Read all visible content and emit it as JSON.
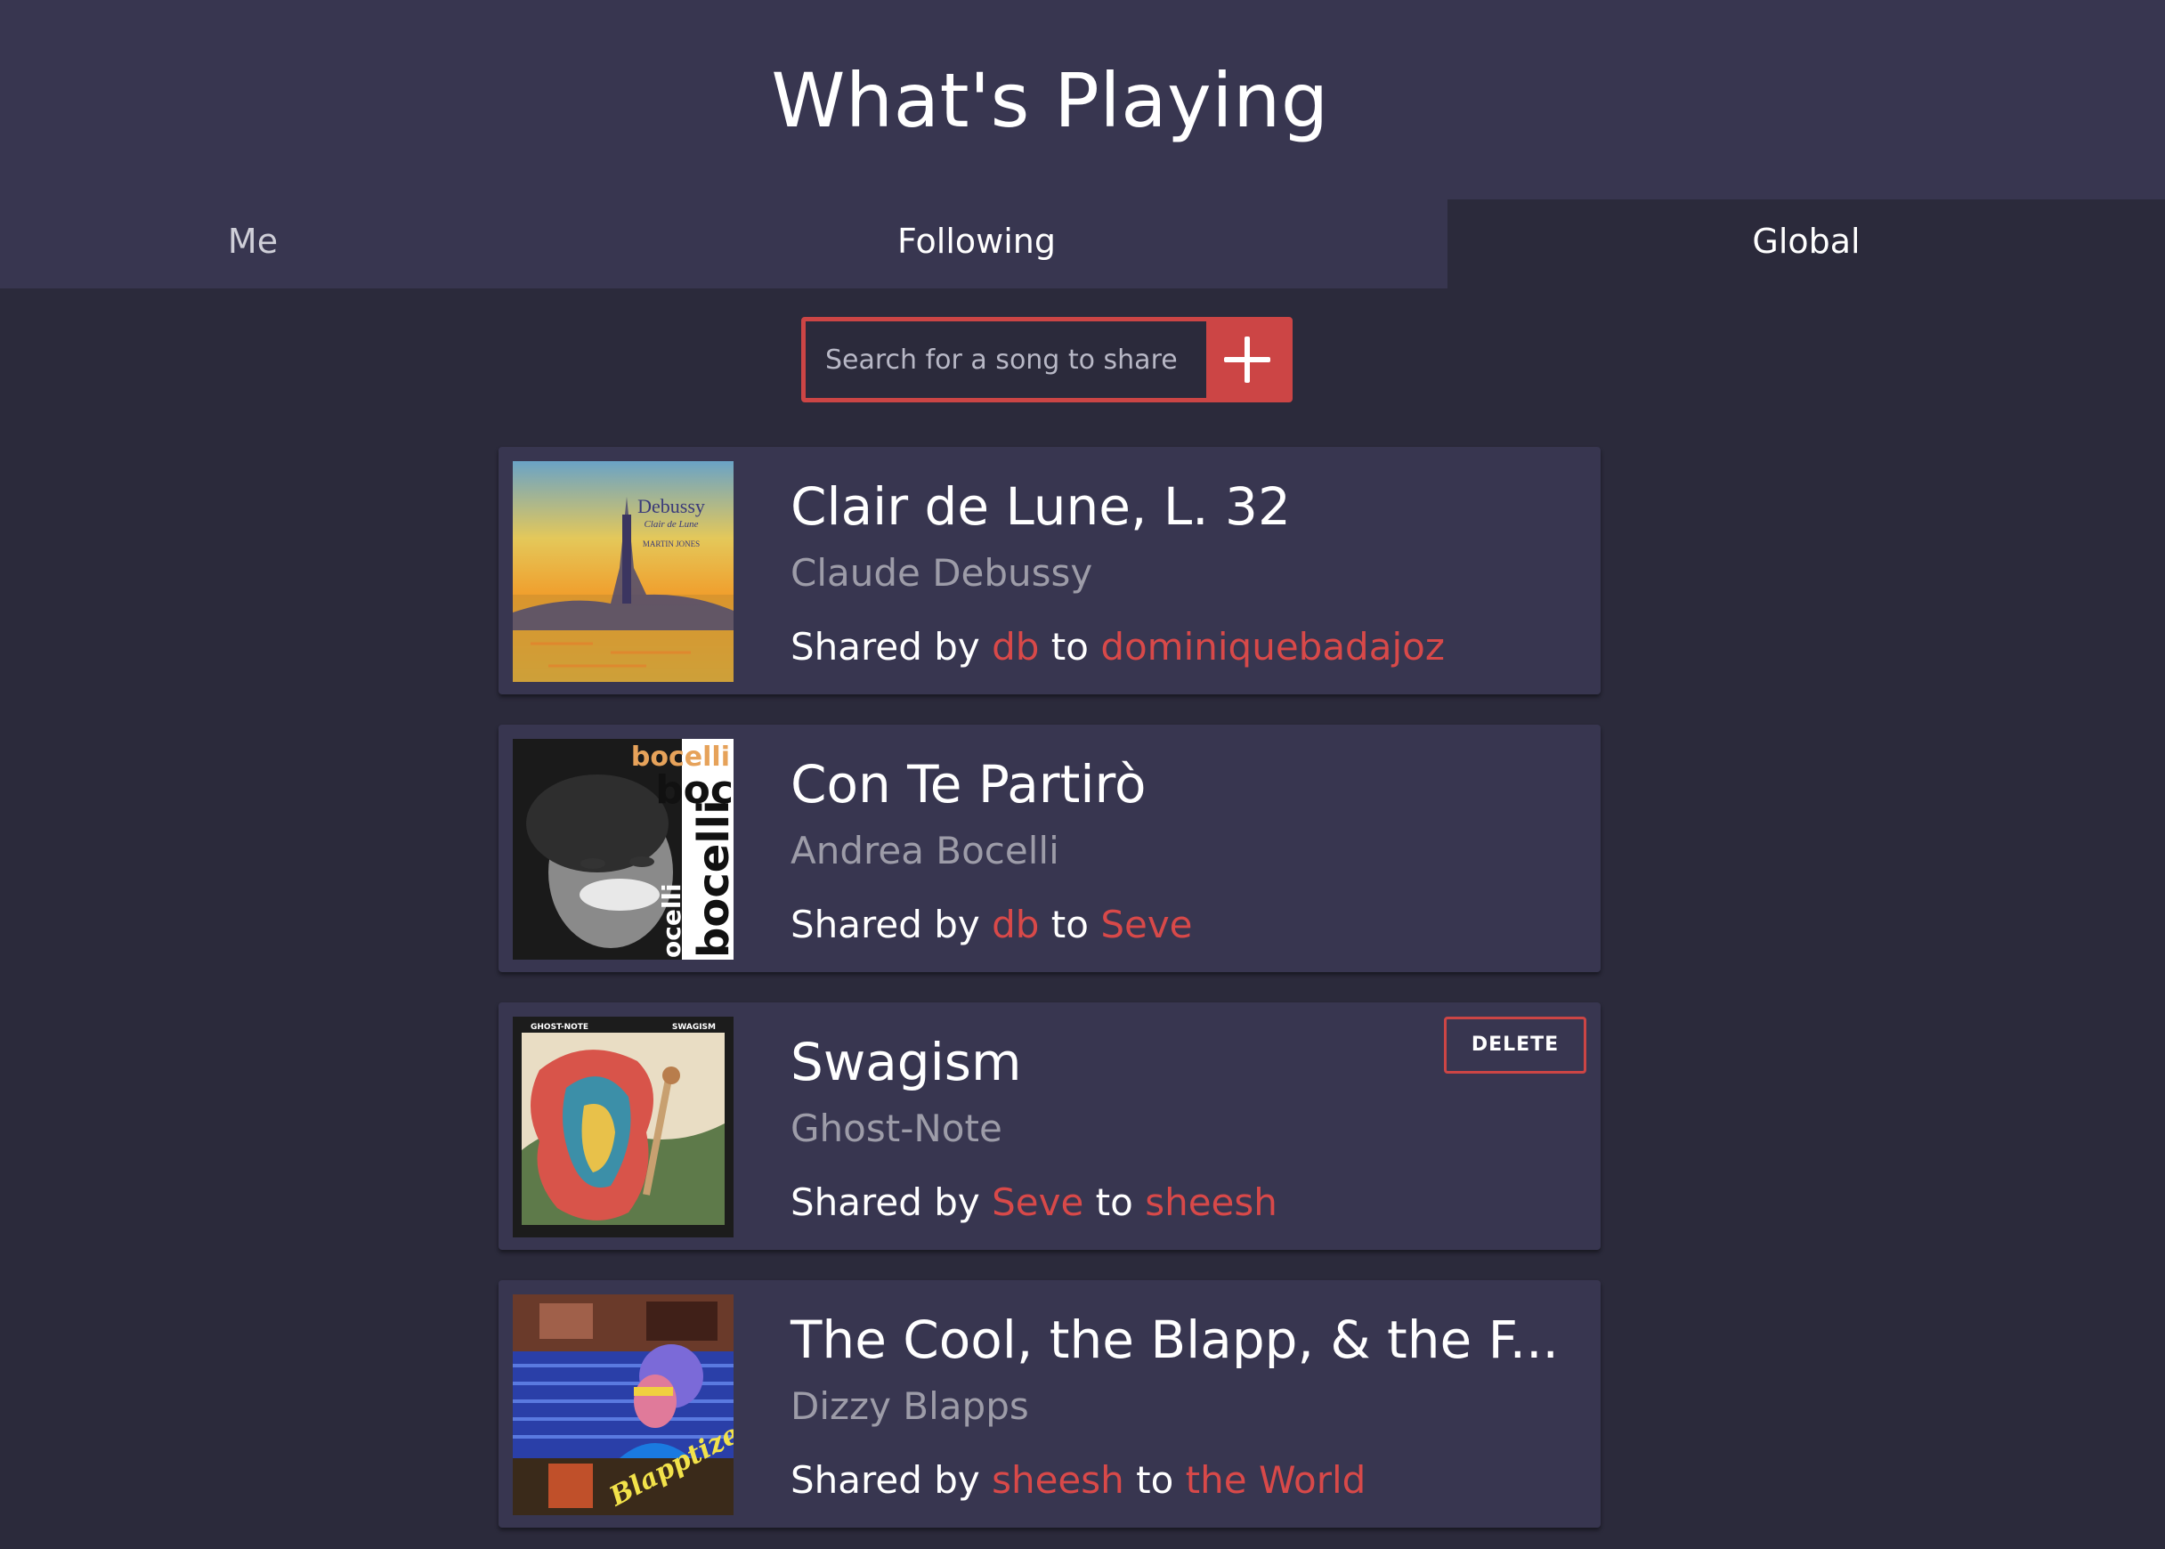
{
  "header": {
    "title": "What's Playing"
  },
  "tabs": [
    {
      "label": "Me"
    },
    {
      "label": "Following"
    },
    {
      "label": "Global"
    }
  ],
  "search": {
    "placeholder": "Search for a song to share",
    "add_label": "+"
  },
  "colors": {
    "accent": "#cc4545",
    "header_bg": "#383650",
    "page_bg": "#2b2a3b",
    "card_bg": "#383650"
  },
  "songs": [
    {
      "title": "Clair de Lune, L. 32",
      "artist": "Claude Debussy",
      "shared_prefix": "Shared by",
      "from": "db",
      "connector": "to",
      "to": "dominiquebadajoz",
      "cover_text": [
        "Debussy",
        "Clair de Lune",
        "MARTIN JONES"
      ]
    },
    {
      "title": "Con Te Partirò",
      "artist": "Andrea Bocelli",
      "shared_prefix": "Shared by",
      "from": "db",
      "connector": "to",
      "to": "Seve",
      "cover_text": [
        "bocelli",
        "boc",
        "bocelli",
        "ocelli"
      ]
    },
    {
      "title": "Swagism",
      "artist": "Ghost-Note",
      "shared_prefix": "Shared by",
      "from": "Seve",
      "connector": "to",
      "to": "sheesh",
      "delete_label": "DELETE",
      "cover_text": [
        "GHOST-NOTE",
        "SWAGISM"
      ]
    },
    {
      "title": "The Cool, the Blapp, & the F...",
      "artist": "Dizzy Blapps",
      "shared_prefix": "Shared by",
      "from": "sheesh",
      "connector": "to",
      "to": "the World",
      "cover_text": [
        "Blapptized"
      ]
    }
  ]
}
